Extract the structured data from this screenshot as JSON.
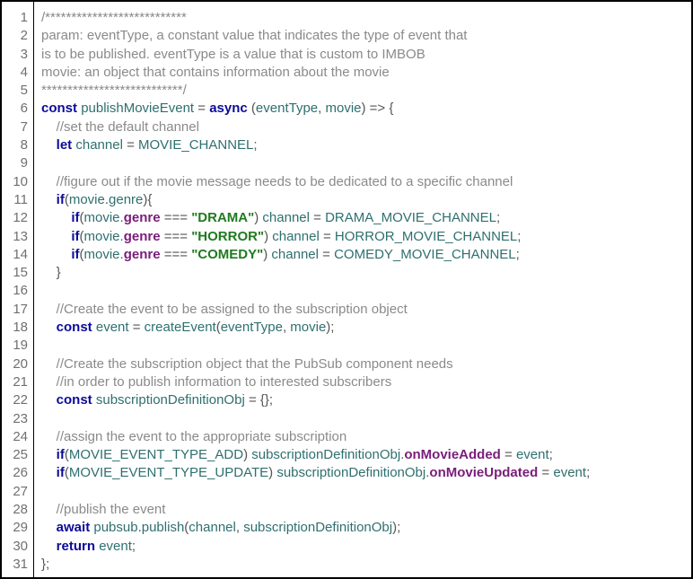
{
  "line_numbers": [
    "1",
    "2",
    "3",
    "4",
    "5",
    "6",
    "7",
    "8",
    "9",
    "10",
    "11",
    "12",
    "13",
    "14",
    "15",
    "16",
    "17",
    "18",
    "19",
    "20",
    "21",
    "22",
    "23",
    "24",
    "25",
    "26",
    "27",
    "28",
    "29",
    "30",
    "31"
  ],
  "chart_data": {
    "type": "table",
    "title": "JavaScript source: publishMovieEvent",
    "code_lines": [
      [
        [
          "comment",
          "/***************************"
        ]
      ],
      [
        [
          "comment",
          "param: eventType, a constant value that indicates the type of event that"
        ]
      ],
      [
        [
          "comment",
          "is to be published. eventType is a value that is custom to IMBOB"
        ]
      ],
      [
        [
          "comment",
          "movie: an object that contains information about the movie"
        ]
      ],
      [
        [
          "comment",
          "***************************/"
        ]
      ],
      [
        [
          "keyword",
          "const"
        ],
        [
          "default",
          " "
        ],
        [
          "ident",
          "publishMovieEvent"
        ],
        [
          "default",
          " "
        ],
        [
          "punct",
          "="
        ],
        [
          "default",
          " "
        ],
        [
          "keyword",
          "async"
        ],
        [
          "default",
          " "
        ],
        [
          "punct",
          "("
        ],
        [
          "ident",
          "eventType"
        ],
        [
          "punct",
          ","
        ],
        [
          "default",
          " "
        ],
        [
          "ident",
          "movie"
        ],
        [
          "punct",
          ")"
        ],
        [
          "default",
          " "
        ],
        [
          "punct",
          "=>"
        ],
        [
          "default",
          " "
        ],
        [
          "punct",
          "{"
        ]
      ],
      [
        [
          "default",
          "    "
        ],
        [
          "comment",
          "//set the default channel"
        ]
      ],
      [
        [
          "default",
          "    "
        ],
        [
          "keyword",
          "let"
        ],
        [
          "default",
          " "
        ],
        [
          "ident",
          "channel"
        ],
        [
          "default",
          " "
        ],
        [
          "punct",
          "="
        ],
        [
          "default",
          " "
        ],
        [
          "ident",
          "MOVIE_CHANNEL"
        ],
        [
          "punct",
          ";"
        ]
      ],
      [
        [
          "default",
          ""
        ]
      ],
      [
        [
          "default",
          "    "
        ],
        [
          "comment",
          "//figure out if the movie message needs to be dedicated to a specific channel"
        ]
      ],
      [
        [
          "default",
          "    "
        ],
        [
          "keyword",
          "if"
        ],
        [
          "punct",
          "("
        ],
        [
          "ident",
          "movie"
        ],
        [
          "punct",
          "."
        ],
        [
          "ident",
          "genre"
        ],
        [
          "punct",
          ")"
        ],
        [
          "punct",
          "{"
        ]
      ],
      [
        [
          "default",
          "        "
        ],
        [
          "keyword",
          "if"
        ],
        [
          "punct",
          "("
        ],
        [
          "ident",
          "movie"
        ],
        [
          "punct",
          "."
        ],
        [
          "prop",
          "genre"
        ],
        [
          "default",
          " "
        ],
        [
          "punct",
          "==="
        ],
        [
          "default",
          " "
        ],
        [
          "string",
          "\"DRAMA\""
        ],
        [
          "punct",
          ")"
        ],
        [
          "default",
          " "
        ],
        [
          "ident",
          "channel"
        ],
        [
          "default",
          " "
        ],
        [
          "punct",
          "="
        ],
        [
          "default",
          " "
        ],
        [
          "ident",
          "DRAMA_MOVIE_CHANNEL"
        ],
        [
          "punct",
          ";"
        ]
      ],
      [
        [
          "default",
          "        "
        ],
        [
          "keyword",
          "if"
        ],
        [
          "punct",
          "("
        ],
        [
          "ident",
          "movie"
        ],
        [
          "punct",
          "."
        ],
        [
          "prop",
          "genre"
        ],
        [
          "default",
          " "
        ],
        [
          "punct",
          "==="
        ],
        [
          "default",
          " "
        ],
        [
          "string",
          "\"HORROR\""
        ],
        [
          "punct",
          ")"
        ],
        [
          "default",
          " "
        ],
        [
          "ident",
          "channel"
        ],
        [
          "default",
          " "
        ],
        [
          "punct",
          "="
        ],
        [
          "default",
          " "
        ],
        [
          "ident",
          "HORROR_MOVIE_CHANNEL"
        ],
        [
          "punct",
          ";"
        ]
      ],
      [
        [
          "default",
          "        "
        ],
        [
          "keyword",
          "if"
        ],
        [
          "punct",
          "("
        ],
        [
          "ident",
          "movie"
        ],
        [
          "punct",
          "."
        ],
        [
          "prop",
          "genre"
        ],
        [
          "default",
          " "
        ],
        [
          "punct",
          "==="
        ],
        [
          "default",
          " "
        ],
        [
          "string",
          "\"COMEDY\""
        ],
        [
          "punct",
          ")"
        ],
        [
          "default",
          " "
        ],
        [
          "ident",
          "channel"
        ],
        [
          "default",
          " "
        ],
        [
          "punct",
          "="
        ],
        [
          "default",
          " "
        ],
        [
          "ident",
          "COMEDY_MOVIE_CHANNEL"
        ],
        [
          "punct",
          ";"
        ]
      ],
      [
        [
          "default",
          "    "
        ],
        [
          "punct",
          "}"
        ]
      ],
      [
        [
          "default",
          ""
        ]
      ],
      [
        [
          "default",
          "    "
        ],
        [
          "comment",
          "//Create the event to be assigned to the subscription object"
        ]
      ],
      [
        [
          "default",
          "    "
        ],
        [
          "keyword",
          "const"
        ],
        [
          "default",
          " "
        ],
        [
          "ident",
          "event"
        ],
        [
          "default",
          " "
        ],
        [
          "punct",
          "="
        ],
        [
          "default",
          " "
        ],
        [
          "ident",
          "createEvent"
        ],
        [
          "punct",
          "("
        ],
        [
          "ident",
          "eventType"
        ],
        [
          "punct",
          ","
        ],
        [
          "default",
          " "
        ],
        [
          "ident",
          "movie"
        ],
        [
          "punct",
          ")"
        ],
        [
          "punct",
          ";"
        ]
      ],
      [
        [
          "default",
          ""
        ]
      ],
      [
        [
          "default",
          "    "
        ],
        [
          "comment",
          "//Create the subscription object that the PubSub component needs"
        ]
      ],
      [
        [
          "default",
          "    "
        ],
        [
          "comment",
          "//in order to publish information to interested subscribers"
        ]
      ],
      [
        [
          "default",
          "    "
        ],
        [
          "keyword",
          "const"
        ],
        [
          "default",
          " "
        ],
        [
          "ident",
          "subscriptionDefinitionObj"
        ],
        [
          "default",
          " "
        ],
        [
          "punct",
          "="
        ],
        [
          "default",
          " "
        ],
        [
          "punct",
          "{"
        ],
        [
          "punct",
          "}"
        ],
        [
          "punct",
          ";"
        ]
      ],
      [
        [
          "default",
          ""
        ]
      ],
      [
        [
          "default",
          "    "
        ],
        [
          "comment",
          "//assign the event to the appropriate subscription"
        ]
      ],
      [
        [
          "default",
          "    "
        ],
        [
          "keyword",
          "if"
        ],
        [
          "punct",
          "("
        ],
        [
          "ident",
          "MOVIE_EVENT_TYPE_ADD"
        ],
        [
          "punct",
          ")"
        ],
        [
          "default",
          " "
        ],
        [
          "ident",
          "subscriptionDefinitionObj"
        ],
        [
          "punct",
          "."
        ],
        [
          "prop",
          "onMovieAdded"
        ],
        [
          "default",
          " "
        ],
        [
          "punct",
          "="
        ],
        [
          "default",
          " "
        ],
        [
          "ident",
          "event"
        ],
        [
          "punct",
          ";"
        ]
      ],
      [
        [
          "default",
          "    "
        ],
        [
          "keyword",
          "if"
        ],
        [
          "punct",
          "("
        ],
        [
          "ident",
          "MOVIE_EVENT_TYPE_UPDATE"
        ],
        [
          "punct",
          ")"
        ],
        [
          "default",
          " "
        ],
        [
          "ident",
          "subscriptionDefinitionObj"
        ],
        [
          "punct",
          "."
        ],
        [
          "prop",
          "onMovieUpdated"
        ],
        [
          "default",
          " "
        ],
        [
          "punct",
          "="
        ],
        [
          "default",
          " "
        ],
        [
          "ident",
          "event"
        ],
        [
          "punct",
          ";"
        ]
      ],
      [
        [
          "default",
          ""
        ]
      ],
      [
        [
          "default",
          "    "
        ],
        [
          "comment",
          "//publish the event"
        ]
      ],
      [
        [
          "default",
          "    "
        ],
        [
          "keyword",
          "await"
        ],
        [
          "default",
          " "
        ],
        [
          "ident",
          "pubsub"
        ],
        [
          "punct",
          "."
        ],
        [
          "ident",
          "publish"
        ],
        [
          "punct",
          "("
        ],
        [
          "ident",
          "channel"
        ],
        [
          "punct",
          ","
        ],
        [
          "default",
          " "
        ],
        [
          "ident",
          "subscriptionDefinitionObj"
        ],
        [
          "punct",
          ")"
        ],
        [
          "punct",
          ";"
        ]
      ],
      [
        [
          "default",
          "    "
        ],
        [
          "keyword",
          "return"
        ],
        [
          "default",
          " "
        ],
        [
          "ident",
          "event"
        ],
        [
          "punct",
          ";"
        ]
      ],
      [
        [
          "punct",
          "}"
        ],
        [
          "punct",
          ";"
        ]
      ]
    ]
  }
}
